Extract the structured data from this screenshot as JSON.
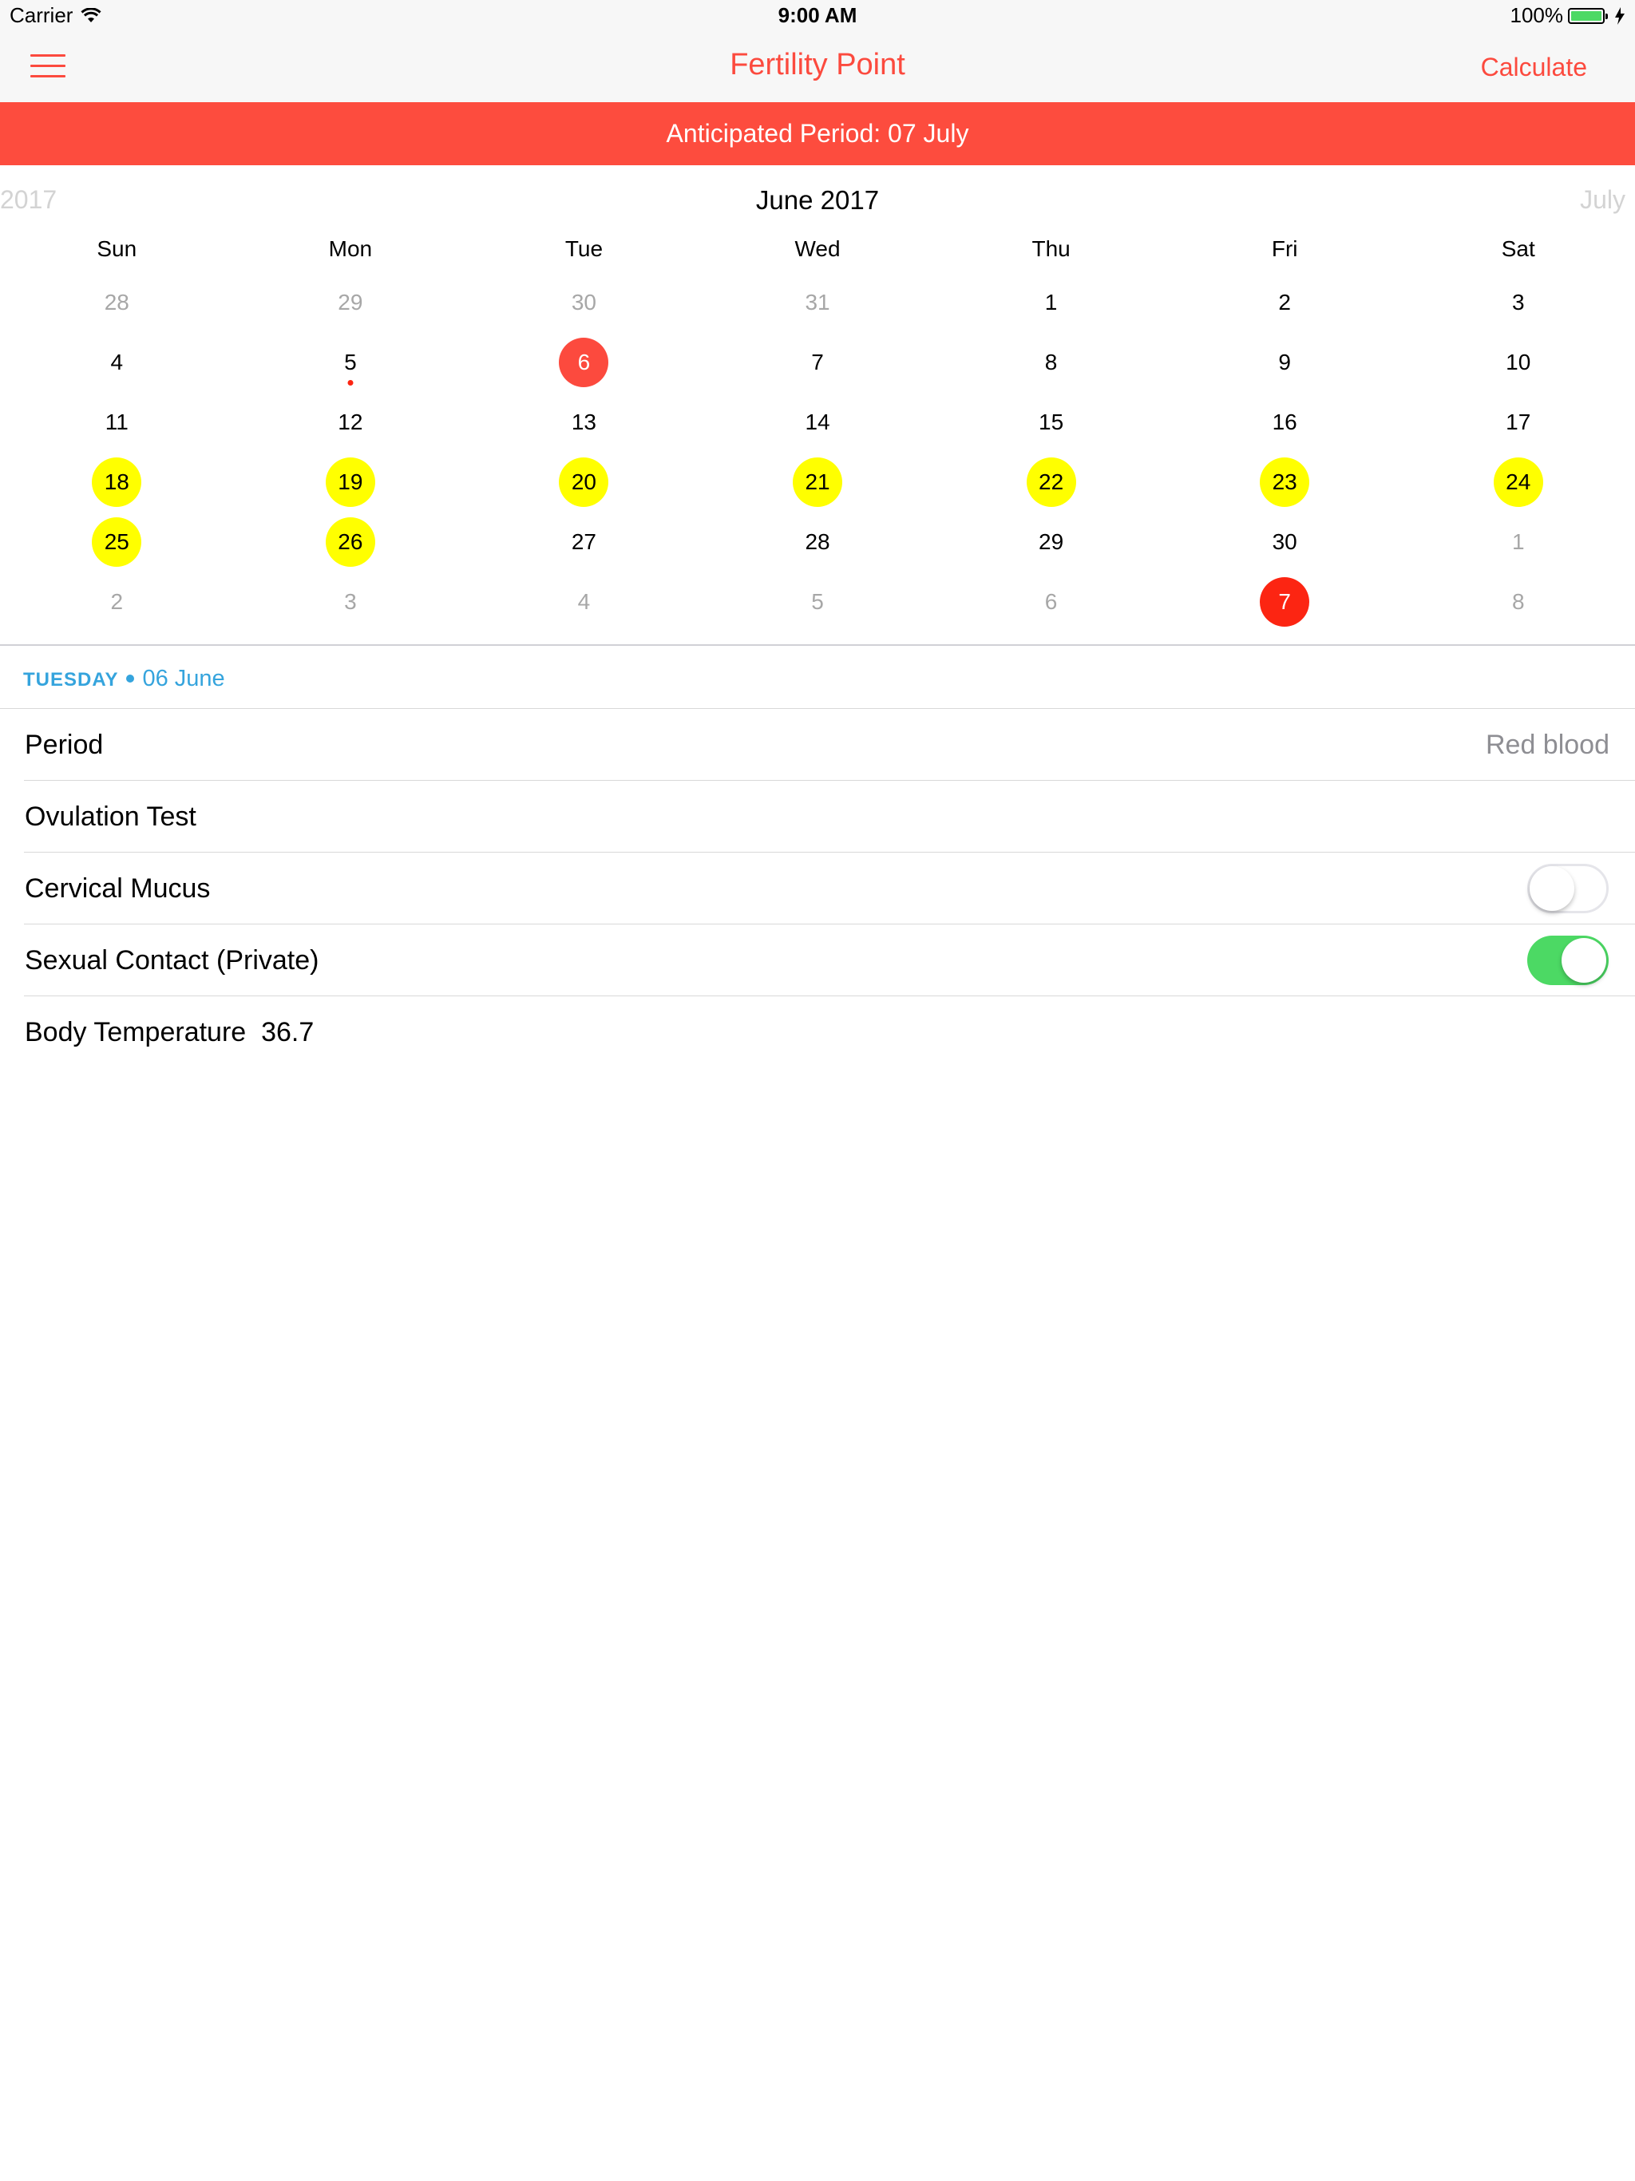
{
  "status_bar": {
    "carrier": "Carrier",
    "time": "9:00 AM",
    "battery": "100%"
  },
  "nav": {
    "title": "Fertility Point",
    "action": "Calculate"
  },
  "banner": {
    "text": "Anticipated Period: 07 July"
  },
  "calendar": {
    "prev_month": "2017",
    "month_title": "June 2017",
    "next_month": "July",
    "weekdays": [
      "Sun",
      "Mon",
      "Tue",
      "Wed",
      "Thu",
      "Fri",
      "Sat"
    ],
    "weeks": [
      [
        {
          "d": "28",
          "state": "outside"
        },
        {
          "d": "29",
          "state": "outside"
        },
        {
          "d": "30",
          "state": "outside"
        },
        {
          "d": "31",
          "state": "outside"
        },
        {
          "d": "1"
        },
        {
          "d": "2"
        },
        {
          "d": "3"
        }
      ],
      [
        {
          "d": "4"
        },
        {
          "d": "5",
          "dot": true
        },
        {
          "d": "6",
          "state": "selected"
        },
        {
          "d": "7"
        },
        {
          "d": "8"
        },
        {
          "d": "9"
        },
        {
          "d": "10"
        }
      ],
      [
        {
          "d": "11"
        },
        {
          "d": "12"
        },
        {
          "d": "13"
        },
        {
          "d": "14"
        },
        {
          "d": "15"
        },
        {
          "d": "16"
        },
        {
          "d": "17"
        }
      ],
      [
        {
          "d": "18",
          "state": "fertile"
        },
        {
          "d": "19",
          "state": "fertile"
        },
        {
          "d": "20",
          "state": "fertile"
        },
        {
          "d": "21",
          "state": "fertile"
        },
        {
          "d": "22",
          "state": "fertile"
        },
        {
          "d": "23",
          "state": "fertile"
        },
        {
          "d": "24",
          "state": "fertile"
        }
      ],
      [
        {
          "d": "25",
          "state": "fertile"
        },
        {
          "d": "26",
          "state": "fertile"
        },
        {
          "d": "27"
        },
        {
          "d": "28"
        },
        {
          "d": "29"
        },
        {
          "d": "30"
        },
        {
          "d": "1",
          "state": "outside"
        }
      ],
      [
        {
          "d": "2",
          "state": "outside"
        },
        {
          "d": "3",
          "state": "outside"
        },
        {
          "d": "4",
          "state": "outside"
        },
        {
          "d": "5",
          "state": "outside"
        },
        {
          "d": "6",
          "state": "outside"
        },
        {
          "d": "7",
          "state": "period"
        },
        {
          "d": "8",
          "state": "outside"
        }
      ]
    ]
  },
  "detail": {
    "weekday": "TUESDAY",
    "date": "06 June",
    "rows": {
      "period": {
        "label": "Period",
        "value": "Red blood"
      },
      "ovulation": {
        "label": "Ovulation Test"
      },
      "mucus": {
        "label": "Cervical Mucus",
        "on": false
      },
      "sexual": {
        "label": "Sexual Contact (Private)",
        "on": true
      },
      "temperature": {
        "label": "Body Temperature",
        "value": "36.7"
      }
    }
  },
  "colors": {
    "accent": "#fc4a3e",
    "fertile": "#ffff00",
    "period": "#fc2512",
    "toggle_on": "#4cd964",
    "date_header": "#35a4dd"
  }
}
